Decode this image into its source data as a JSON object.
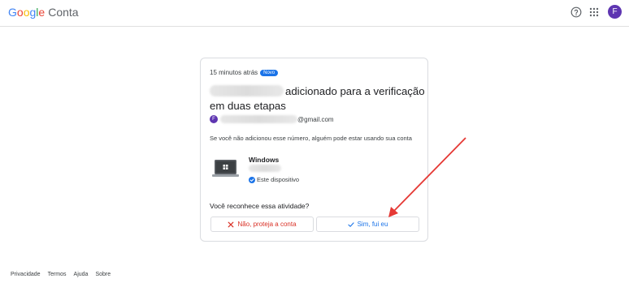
{
  "header": {
    "logo": {
      "g1": "G",
      "o1": "o",
      "o2": "o",
      "g2": "g",
      "l": "l",
      "e": "e",
      "product": "Conta"
    },
    "avatar_letter": "F",
    "icons": [
      "help-icon",
      "apps-grid-icon"
    ]
  },
  "card": {
    "time": "15 minutos atrás",
    "badge": "Novo",
    "headline_text": "adicionado para a verificação em duas etapas",
    "account_avatar_letter": "F",
    "account_email_suffix": "@gmail.com",
    "warning": "Se você não adicionou esse número, alguém pode estar usando sua conta",
    "device": {
      "name": "Windows",
      "this_device_label": "Este dispositivo",
      "icon": "windows-laptop-icon"
    },
    "question": "Você reconhece essa atividade?",
    "buttons": {
      "no_label": "Não, proteja a conta",
      "yes_label": "Sim, fui eu"
    }
  },
  "footer": {
    "links": [
      "Privacidade",
      "Termos",
      "Ajuda",
      "Sobre"
    ]
  },
  "colors": {
    "brand_blue": "#1a73e8",
    "danger_red": "#d93025",
    "avatar_purple": "#5e35b1",
    "annotation_arrow": "#e53935"
  }
}
